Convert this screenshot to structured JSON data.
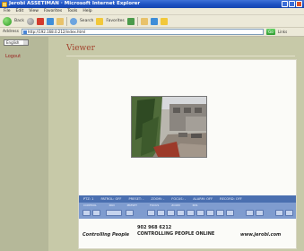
{
  "window": {
    "title": "Jerobi ASSETIMAN · Microsoft Internet Explorer",
    "menu": [
      "File",
      "Edit",
      "View",
      "Favorites",
      "Tools",
      "Help"
    ]
  },
  "toolbar": {
    "back_label": "Back",
    "search_label": "Search",
    "favorites_label": "Favorites"
  },
  "address": {
    "label": "Address",
    "value": "http://192.168.0.212/index.html",
    "go_label": "Go",
    "links_label": "Links"
  },
  "sidebar": {
    "select_value": "English",
    "link_label": "Logout"
  },
  "page": {
    "title": "Viewer"
  },
  "viewer": {
    "status": [
      "PTZ: 1",
      "PATROL: OFF",
      "PRESET: -",
      "ZOOM: -",
      "FOCUS: -",
      "ALARM: OFF",
      "RECORD: OFF"
    ],
    "control_labels": [
      "CONTROL",
      "PAN",
      "PRESET",
      "FOCUS",
      "ZOOM",
      "IRIS"
    ]
  },
  "footer": {
    "phone": "902 968 6212",
    "brand": "Controlling People",
    "tagline": "CONTROLLING PEOPLE ONLINE",
    "website": "www.jerobi.com"
  },
  "colors": {
    "titlebar": "#1b4fc0",
    "page_bg": "#c7c9a8",
    "sidebar_bg": "#b5b899",
    "title_text": "#a2442e",
    "strip": "#4a6fb0",
    "panel": "#7f9ccf"
  }
}
